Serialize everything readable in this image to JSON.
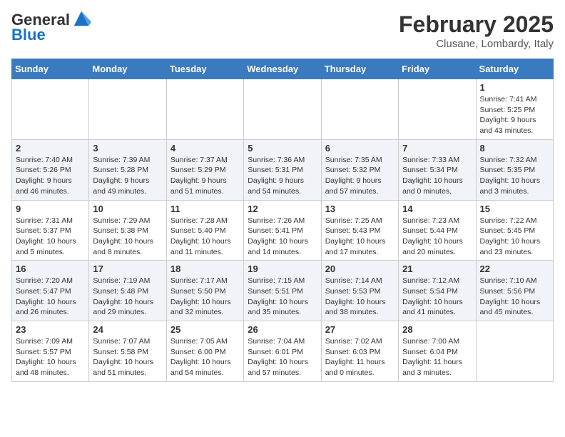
{
  "header": {
    "logo_line1": "General",
    "logo_line2": "Blue",
    "title": "February 2025",
    "subtitle": "Clusane, Lombardy, Italy"
  },
  "days_of_week": [
    "Sunday",
    "Monday",
    "Tuesday",
    "Wednesday",
    "Thursday",
    "Friday",
    "Saturday"
  ],
  "weeks": [
    [
      {
        "day": "",
        "info": ""
      },
      {
        "day": "",
        "info": ""
      },
      {
        "day": "",
        "info": ""
      },
      {
        "day": "",
        "info": ""
      },
      {
        "day": "",
        "info": ""
      },
      {
        "day": "",
        "info": ""
      },
      {
        "day": "1",
        "info": "Sunrise: 7:41 AM\nSunset: 5:25 PM\nDaylight: 9 hours and 43 minutes."
      }
    ],
    [
      {
        "day": "2",
        "info": "Sunrise: 7:40 AM\nSunset: 5:26 PM\nDaylight: 9 hours and 46 minutes."
      },
      {
        "day": "3",
        "info": "Sunrise: 7:39 AM\nSunset: 5:28 PM\nDaylight: 9 hours and 49 minutes."
      },
      {
        "day": "4",
        "info": "Sunrise: 7:37 AM\nSunset: 5:29 PM\nDaylight: 9 hours and 51 minutes."
      },
      {
        "day": "5",
        "info": "Sunrise: 7:36 AM\nSunset: 5:31 PM\nDaylight: 9 hours and 54 minutes."
      },
      {
        "day": "6",
        "info": "Sunrise: 7:35 AM\nSunset: 5:32 PM\nDaylight: 9 hours and 57 minutes."
      },
      {
        "day": "7",
        "info": "Sunrise: 7:33 AM\nSunset: 5:34 PM\nDaylight: 10 hours and 0 minutes."
      },
      {
        "day": "8",
        "info": "Sunrise: 7:32 AM\nSunset: 5:35 PM\nDaylight: 10 hours and 3 minutes."
      }
    ],
    [
      {
        "day": "9",
        "info": "Sunrise: 7:31 AM\nSunset: 5:37 PM\nDaylight: 10 hours and 5 minutes."
      },
      {
        "day": "10",
        "info": "Sunrise: 7:29 AM\nSunset: 5:38 PM\nDaylight: 10 hours and 8 minutes."
      },
      {
        "day": "11",
        "info": "Sunrise: 7:28 AM\nSunset: 5:40 PM\nDaylight: 10 hours and 11 minutes."
      },
      {
        "day": "12",
        "info": "Sunrise: 7:26 AM\nSunset: 5:41 PM\nDaylight: 10 hours and 14 minutes."
      },
      {
        "day": "13",
        "info": "Sunrise: 7:25 AM\nSunset: 5:43 PM\nDaylight: 10 hours and 17 minutes."
      },
      {
        "day": "14",
        "info": "Sunrise: 7:23 AM\nSunset: 5:44 PM\nDaylight: 10 hours and 20 minutes."
      },
      {
        "day": "15",
        "info": "Sunrise: 7:22 AM\nSunset: 5:45 PM\nDaylight: 10 hours and 23 minutes."
      }
    ],
    [
      {
        "day": "16",
        "info": "Sunrise: 7:20 AM\nSunset: 5:47 PM\nDaylight: 10 hours and 26 minutes."
      },
      {
        "day": "17",
        "info": "Sunrise: 7:19 AM\nSunset: 5:48 PM\nDaylight: 10 hours and 29 minutes."
      },
      {
        "day": "18",
        "info": "Sunrise: 7:17 AM\nSunset: 5:50 PM\nDaylight: 10 hours and 32 minutes."
      },
      {
        "day": "19",
        "info": "Sunrise: 7:15 AM\nSunset: 5:51 PM\nDaylight: 10 hours and 35 minutes."
      },
      {
        "day": "20",
        "info": "Sunrise: 7:14 AM\nSunset: 5:53 PM\nDaylight: 10 hours and 38 minutes."
      },
      {
        "day": "21",
        "info": "Sunrise: 7:12 AM\nSunset: 5:54 PM\nDaylight: 10 hours and 41 minutes."
      },
      {
        "day": "22",
        "info": "Sunrise: 7:10 AM\nSunset: 5:56 PM\nDaylight: 10 hours and 45 minutes."
      }
    ],
    [
      {
        "day": "23",
        "info": "Sunrise: 7:09 AM\nSunset: 5:57 PM\nDaylight: 10 hours and 48 minutes."
      },
      {
        "day": "24",
        "info": "Sunrise: 7:07 AM\nSunset: 5:58 PM\nDaylight: 10 hours and 51 minutes."
      },
      {
        "day": "25",
        "info": "Sunrise: 7:05 AM\nSunset: 6:00 PM\nDaylight: 10 hours and 54 minutes."
      },
      {
        "day": "26",
        "info": "Sunrise: 7:04 AM\nSunset: 6:01 PM\nDaylight: 10 hours and 57 minutes."
      },
      {
        "day": "27",
        "info": "Sunrise: 7:02 AM\nSunset: 6:03 PM\nDaylight: 11 hours and 0 minutes."
      },
      {
        "day": "28",
        "info": "Sunrise: 7:00 AM\nSunset: 6:04 PM\nDaylight: 11 hours and 3 minutes."
      },
      {
        "day": "",
        "info": ""
      }
    ]
  ]
}
